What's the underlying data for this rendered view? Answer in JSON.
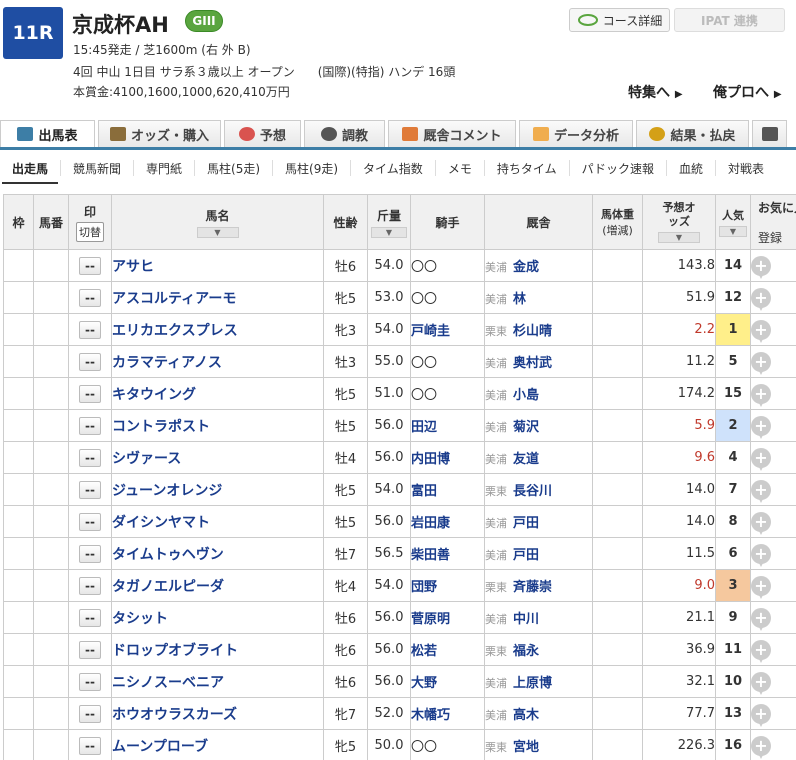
{
  "race": {
    "number": "11R",
    "name": "京成杯AH",
    "grade": "GIII",
    "info_line1": "15:45発走 / 芝1600m (右 外 B)",
    "info_line2": "4回 中山 1日目 サラ系３歳以上 オープン      (国際)(特指) ハンデ 16頭",
    "info_line3": "本賞金:4100,1600,1000,620,410万円"
  },
  "header_buttons": {
    "course_detail": "コース詳細",
    "ipat": "IPAT 連携",
    "tokushu": "特集へ",
    "orepro": "俺プロへ"
  },
  "tabs": [
    {
      "label": "出馬表",
      "icon": "table-icon",
      "color": "#3d7ea6"
    },
    {
      "label": "オッズ・購入",
      "icon": "odds-icon",
      "color": "#8a6d3b"
    },
    {
      "label": "予想",
      "icon": "target-icon",
      "color": "#d9534f"
    },
    {
      "label": "調教",
      "icon": "stopwatch-icon",
      "color": "#555555"
    },
    {
      "label": "厩舎コメント",
      "icon": "stable-icon",
      "color": "#e07b39"
    },
    {
      "label": "データ分析",
      "icon": "bar-chart-icon",
      "color": "#f0ad4e"
    },
    {
      "label": "結果・払戻",
      "icon": "coins-icon",
      "color": "#d4a017"
    },
    {
      "label": "",
      "icon": "video-icon",
      "color": "#555555"
    }
  ],
  "subnav": [
    "出走馬",
    "競馬新聞",
    "専門紙",
    "馬柱(5走)",
    "馬柱(9走)",
    "タイム指数",
    "メモ",
    "持ちタイム",
    "パドック速報",
    "血統",
    "対戦表"
  ],
  "table": {
    "headers": {
      "waku": "枠",
      "umaban": "馬番",
      "mark": "印",
      "kirikae": "切替",
      "horse": "馬名",
      "sexage": "性齢",
      "weight": "斤量",
      "jockey": "騎手",
      "trainer": "厩舎",
      "body_weight": "馬体重",
      "body_weight_sub": "(増減)",
      "odds": "予想オッズ",
      "pop": "人気",
      "fav": "お気に入",
      "fav_sub": "登録"
    },
    "mark_placeholder": "--",
    "rows": [
      {
        "horse": "アサヒ",
        "sexage": "牡6",
        "weight": "54.0",
        "jockey": "〇〇",
        "jockey_linked": false,
        "area": "美浦",
        "trainer": "金成",
        "odds": "143.8",
        "pop": "14"
      },
      {
        "horse": "アスコルティアーモ",
        "sexage": "牝5",
        "weight": "53.0",
        "jockey": "〇〇",
        "jockey_linked": false,
        "area": "美浦",
        "trainer": "林",
        "odds": "51.9",
        "pop": "12"
      },
      {
        "horse": "エリカエクスプレス",
        "sexage": "牝3",
        "weight": "54.0",
        "jockey": "戸崎圭",
        "jockey_linked": true,
        "area": "栗東",
        "trainer": "杉山晴",
        "odds": "2.2",
        "pop": "1"
      },
      {
        "horse": "カラマティアノス",
        "sexage": "牡3",
        "weight": "55.0",
        "jockey": "〇〇",
        "jockey_linked": false,
        "area": "美浦",
        "trainer": "奥村武",
        "odds": "11.2",
        "pop": "5"
      },
      {
        "horse": "キタウイング",
        "sexage": "牝5",
        "weight": "51.0",
        "jockey": "〇〇",
        "jockey_linked": false,
        "area": "美浦",
        "trainer": "小島",
        "odds": "174.2",
        "pop": "15"
      },
      {
        "horse": "コントラポスト",
        "sexage": "牡5",
        "weight": "56.0",
        "jockey": "田辺",
        "jockey_linked": true,
        "area": "美浦",
        "trainer": "菊沢",
        "odds": "5.9",
        "pop": "2"
      },
      {
        "horse": "シヴァース",
        "sexage": "牡4",
        "weight": "56.0",
        "jockey": "内田博",
        "jockey_linked": true,
        "area": "美浦",
        "trainer": "友道",
        "odds": "9.6",
        "pop": "4"
      },
      {
        "horse": "ジューンオレンジ",
        "sexage": "牝5",
        "weight": "54.0",
        "jockey": "富田",
        "jockey_linked": true,
        "area": "栗東",
        "trainer": "長谷川",
        "odds": "14.0",
        "pop": "7"
      },
      {
        "horse": "ダイシンヤマト",
        "sexage": "牡5",
        "weight": "56.0",
        "jockey": "岩田康",
        "jockey_linked": true,
        "area": "美浦",
        "trainer": "戸田",
        "odds": "14.0",
        "pop": "8"
      },
      {
        "horse": "タイムトゥヘヴン",
        "sexage": "牡7",
        "weight": "56.5",
        "jockey": "柴田善",
        "jockey_linked": true,
        "area": "美浦",
        "trainer": "戸田",
        "odds": "11.5",
        "pop": "6"
      },
      {
        "horse": "タガノエルピーダ",
        "sexage": "牝4",
        "weight": "54.0",
        "jockey": "団野",
        "jockey_linked": true,
        "area": "栗東",
        "trainer": "斉藤崇",
        "odds": "9.0",
        "pop": "3"
      },
      {
        "horse": "タシット",
        "sexage": "牡6",
        "weight": "56.0",
        "jockey": "菅原明",
        "jockey_linked": true,
        "area": "美浦",
        "trainer": "中川",
        "odds": "21.1",
        "pop": "9"
      },
      {
        "horse": "ドロップオブライト",
        "sexage": "牝6",
        "weight": "56.0",
        "jockey": "松若",
        "jockey_linked": true,
        "area": "栗東",
        "trainer": "福永",
        "odds": "36.9",
        "pop": "11"
      },
      {
        "horse": "ニシノスーベニア",
        "sexage": "牡6",
        "weight": "56.0",
        "jockey": "大野",
        "jockey_linked": true,
        "area": "美浦",
        "trainer": "上原博",
        "odds": "32.1",
        "pop": "10"
      },
      {
        "horse": "ホウオウラスカーズ",
        "sexage": "牝7",
        "weight": "52.0",
        "jockey": "木幡巧",
        "jockey_linked": true,
        "area": "美浦",
        "trainer": "高木",
        "odds": "77.7",
        "pop": "13"
      },
      {
        "horse": "ムーンプローブ",
        "sexage": "牝5",
        "weight": "50.0",
        "jockey": "〇〇",
        "jockey_linked": false,
        "area": "栗東",
        "trainer": "宮地",
        "odds": "226.3",
        "pop": "16"
      }
    ]
  },
  "colors": {
    "race_badge": "#1f4ea3",
    "grade_badge": "#5aa53f",
    "link_blue": "#1a3c8c",
    "hot_odds": "#c0392b",
    "pop1": "#ffef8a",
    "pop2": "#cfe2fb",
    "pop3": "#f5c89e"
  }
}
